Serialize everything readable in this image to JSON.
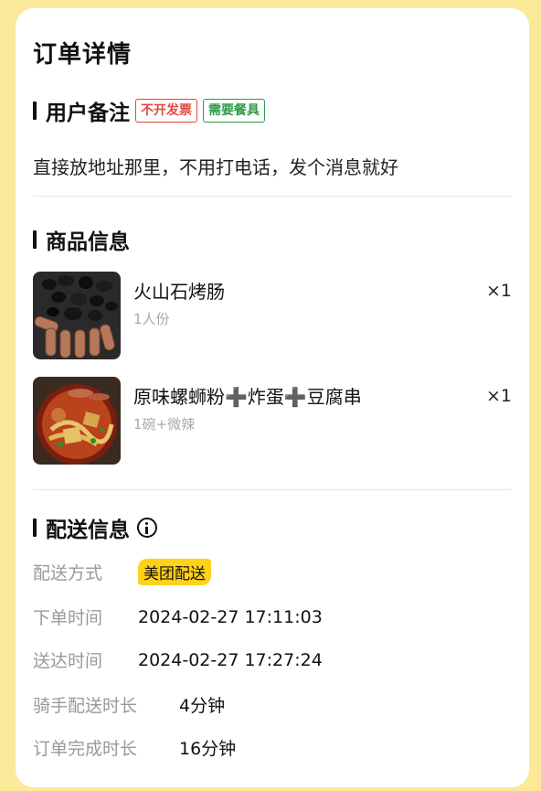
{
  "page_title": "订单详情",
  "remark": {
    "title": "用户备注",
    "tags": [
      {
        "label": "不开发票",
        "color": "#e2483c"
      },
      {
        "label": "需要餐具",
        "color": "#2f9a4a"
      }
    ],
    "text": "直接放地址那里，不用打电话，发个消息就好"
  },
  "products": {
    "title": "商品信息",
    "items": [
      {
        "name": "火山石烤肠",
        "spec": "1人份",
        "qty": "×1"
      },
      {
        "name": "原味螺蛳粉➕炸蛋➕豆腐串",
        "spec": "1碗+微辣",
        "qty": "×1"
      }
    ]
  },
  "delivery": {
    "title": "配送信息",
    "rows": [
      {
        "label": "配送方式",
        "value": "美团配送"
      },
      {
        "label": "下单时间",
        "value": "2024-02-27 17:11:03"
      },
      {
        "label": "送达时间",
        "value": "2024-02-27 17:27:24"
      },
      {
        "label": "骑手配送时长",
        "value": "4分钟"
      },
      {
        "label": "订单完成时长",
        "value": "16分钟"
      }
    ],
    "badge_color": "#ffd21a"
  },
  "colors": {
    "background": "#fbe99a",
    "card": "#ffffff"
  }
}
